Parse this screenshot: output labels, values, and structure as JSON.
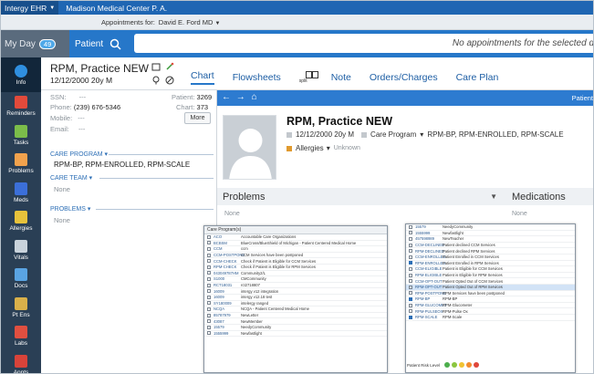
{
  "topbar": {
    "app": "Intergy EHR",
    "facility": "Madison Medical Center P. A."
  },
  "appointments": {
    "label": "Appointments for:",
    "provider": "David E. Ford MD"
  },
  "nav": {
    "myday": "My Day",
    "myday_count": "49",
    "patient": "Patient",
    "search_text": "No appointments for the selected d"
  },
  "rail": [
    {
      "label": "Info",
      "color": "#2f8fe0"
    },
    {
      "label": "Reminders",
      "color": "#e24a3b"
    },
    {
      "label": "Tasks",
      "color": "#7bbd4a"
    },
    {
      "label": "Problems",
      "color": "#f1a24d"
    },
    {
      "label": "Meds",
      "color": "#3b6fd9"
    },
    {
      "label": "Allergies",
      "color": "#e7c23b"
    },
    {
      "label": "Vitals",
      "color": "#c9d3dc"
    },
    {
      "label": "Docs",
      "color": "#5aa4e3"
    },
    {
      "label": "Pt Ens",
      "color": "#d9b04a"
    },
    {
      "label": "Labs",
      "color": "#e04f40"
    },
    {
      "label": "Appts",
      "color": "#d8433a"
    }
  ],
  "patient": {
    "name": "RPM, Practice NEW",
    "dob_line": "12/12/2000 20y M",
    "tabs": [
      "Chart",
      "Flowsheets",
      "Note",
      "Orders/Charges",
      "Care Plan"
    ],
    "split_label": "split"
  },
  "side": {
    "ssn_label": "SSN:",
    "ssn_value": "---",
    "phone_label": "Phone:",
    "phone_value": "(239) 676-5346",
    "mobile_label": "Mobile:",
    "mobile_value": "---",
    "email_label": "Email:",
    "email_value": "---",
    "patient_label": "Patient:",
    "patient_value": "3269",
    "chart_label": "Chart:",
    "chart_value": "373",
    "more": "More",
    "care_program_title": "CARE PROGRAM",
    "care_program_value": "RPM-BP, RPM-ENROLLED, RPM-SCALE",
    "care_team_title": "CARE TEAM",
    "care_team_value": "None",
    "problems_title": "PROBLEMS",
    "problems_value": "None"
  },
  "main": {
    "patient_label": "Patient",
    "name": "RPM, Practice NEW",
    "dob": "12/12/2000 20y M",
    "care_program_label": "Care Program",
    "care_program_value": "RPM-BP, RPM-ENROLLED, RPM-SCALE",
    "allergies_label": "Allergies",
    "allergies_value": "Unknown",
    "problems_title": "Problems",
    "medications_title": "Medications",
    "problems_none": "None",
    "medications_none": "None"
  },
  "care_list_left": {
    "title": "Care Program(s)",
    "items": [
      {
        "code": "ACO",
        "desc": "Accountable Care Organizations",
        "on": false
      },
      {
        "code": "BCBSM",
        "desc": "BlueCross/BlueShield of Michigan - Patient Centered Medical Home",
        "on": false
      },
      {
        "code": "CCM",
        "desc": "ccm",
        "on": false
      },
      {
        "code": "CCM-POSTPONE",
        "desc": "CCM Services have been postponed",
        "on": false
      },
      {
        "code": "CCM-CHECK",
        "desc": "Check if Patient is Eligible for CCM Services",
        "on": false
      },
      {
        "code": "RPM-CHECK",
        "desc": "Check if Patient is Eligible for RPM Services",
        "on": false
      },
      {
        "code": "043049787HM",
        "desc": "Community2/L",
        "on": false
      },
      {
        "code": "S1000",
        "desc": "CMCommunity",
        "on": false
      },
      {
        "code": "RCT18031",
        "desc": "rct2718807",
        "on": false
      },
      {
        "code": "16009",
        "desc": "intergy v12 integration",
        "on": false
      },
      {
        "code": "16009",
        "desc": "intergy v12.18 test",
        "on": false
      },
      {
        "code": "SY180009",
        "desc": "intelergy ranged",
        "on": false
      },
      {
        "code": "NCQA",
        "desc": "NCQA - Patient Centered Medical Home",
        "on": false
      },
      {
        "code": "85787979",
        "desc": "NewLetter",
        "on": false
      },
      {
        "code": "43087",
        "desc": "NewMember",
        "on": false
      },
      {
        "code": "15579",
        "desc": "NeedyCommunity",
        "on": false
      },
      {
        "code": "1555999",
        "desc": "Newfastlight",
        "on": false
      }
    ]
  },
  "care_list_right": {
    "items": [
      {
        "code": "15579",
        "desc": "NeedyCommunity",
        "on": false,
        "sel": false
      },
      {
        "code": "1555999",
        "desc": "Newfastlight",
        "on": false,
        "sel": false
      },
      {
        "code": "457598989",
        "desc": "NewTeacher",
        "on": false,
        "sel": false
      },
      {
        "code": "CCM-DECLINED",
        "desc": "Patient declined CCM Services",
        "on": false,
        "sel": false
      },
      {
        "code": "RPM-DECLINED",
        "desc": "Patient declined RPM Services",
        "on": false,
        "sel": false
      },
      {
        "code": "CCM-ENROLLED",
        "desc": "Patient Enrolled in CCM Services",
        "on": false,
        "sel": false
      },
      {
        "code": "RPM-ENROLLED",
        "desc": "Patient Enrolled in RPM Services",
        "on": true,
        "sel": false
      },
      {
        "code": "CCM-ELIGIBLE",
        "desc": "Patient is Eligible for CCM Services",
        "on": false,
        "sel": false
      },
      {
        "code": "RPM-ELIGIBLE",
        "desc": "Patient is Eligible for RPM Services",
        "on": false,
        "sel": false
      },
      {
        "code": "CCM-OPT-OUT",
        "desc": "Patient Opted Out of CCM Services",
        "on": false,
        "sel": false
      },
      {
        "code": "RPM-OPT-OUT",
        "desc": "Patient Opted Out of RPM Services",
        "on": false,
        "sel": true
      },
      {
        "code": "RPM-POSTPONE",
        "desc": "RPM Services have been postponed",
        "on": false,
        "sel": false
      },
      {
        "code": "RPM-BP",
        "desc": "RPM-BP",
        "on": true,
        "sel": false
      },
      {
        "code": "RPM-GLUCOMET",
        "desc": "RPM-Glucometer",
        "on": false,
        "sel": false
      },
      {
        "code": "RPM-PULSEOX",
        "desc": "RPM-Pulse Ox",
        "on": false,
        "sel": false
      },
      {
        "code": "RPM-SCALE",
        "desc": "RPM-Scale",
        "on": true,
        "sel": false
      }
    ],
    "risk_label": "Patient Risk Level",
    "risk_colors": [
      "#4cae4c",
      "#8cc63f",
      "#f1c232",
      "#f28b2e",
      "#e0463a"
    ]
  }
}
